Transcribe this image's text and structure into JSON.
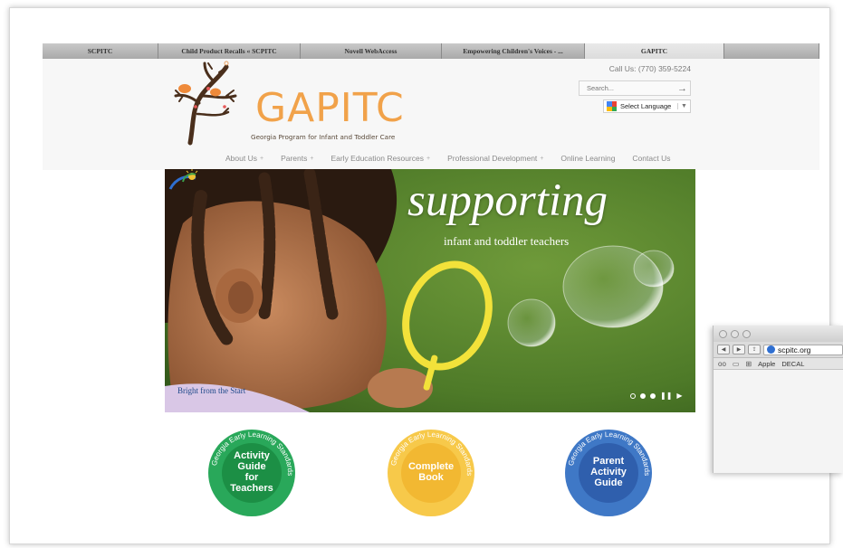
{
  "browser": {
    "tabs": [
      {
        "label": "SCPITC",
        "active": false
      },
      {
        "label": "Child Product Recalls « SCPITC",
        "active": false
      },
      {
        "label": "Novell WebAccess",
        "active": false
      },
      {
        "label": "Empowering Children's Voices - ...",
        "active": false
      },
      {
        "label": "GAPITC",
        "active": true
      },
      {
        "label": "",
        "active": false
      }
    ]
  },
  "header": {
    "logo_text": "GAPITC",
    "logo_subtitle": "Georgia Program for Infant and Toddler Care",
    "call_us": "Call Us: (770) 359-5224",
    "search_placeholder": "Search...",
    "search_arrow": "→",
    "language_label": "Select Language",
    "language_caret": "▼"
  },
  "nav": {
    "items": [
      {
        "label": "About Us",
        "has_dropdown": true
      },
      {
        "label": "Parents",
        "has_dropdown": true
      },
      {
        "label": "Early Education Resources",
        "has_dropdown": true
      },
      {
        "label": "Professional Development",
        "has_dropdown": true
      },
      {
        "label": "Online Learning",
        "has_dropdown": false
      },
      {
        "label": "Contact Us",
        "has_dropdown": false
      }
    ],
    "dropdown_glyph": "+"
  },
  "hero": {
    "title": "supporting",
    "subtitle": "infant and toddler teachers",
    "logo_text": "Bright from the Start",
    "controls": {
      "pause": "❚❚",
      "next": "▶"
    }
  },
  "badges": [
    {
      "ring_text": "Georgia Early Learning Standards",
      "label": "Activity\nGuide\nfor\nTeachers",
      "color": "#29a85a"
    },
    {
      "ring_text": "Georgia Early Learning Standards",
      "label": "Complete\nBook",
      "color": "#f7c94a"
    },
    {
      "ring_text": "Georgia Early Learning Standards",
      "label": "Parent\nActivity\nGuide",
      "color": "#3f78c6"
    }
  ],
  "mini_window": {
    "url": "scpitc.org",
    "bookmarks": [
      "Apple",
      "DECAL"
    ],
    "icons": [
      "reader-glasses-icon",
      "book-icon",
      "grid-icon"
    ]
  },
  "colors": {
    "brand_orange": "#f1a24a",
    "nav_gray": "#8a8a8a",
    "hero_green": "#3f6a22"
  }
}
